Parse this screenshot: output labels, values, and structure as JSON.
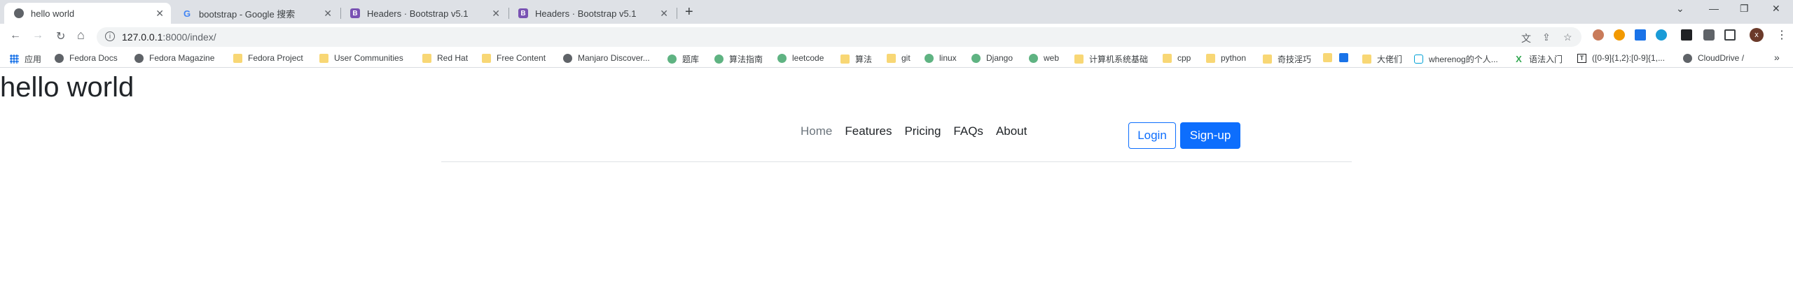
{
  "tabs": [
    {
      "title": "hello world",
      "icon": "globe-icon",
      "active": true
    },
    {
      "title": "bootstrap - Google 搜索",
      "icon": "google-icon"
    },
    {
      "title": "Headers · Bootstrap v5.1",
      "icon": "bootstrap-icon"
    },
    {
      "title": "Headers · Bootstrap v5.1",
      "icon": "bootstrap-icon"
    }
  ],
  "favicon_letters": {
    "google": "G",
    "bootstrap": "B"
  },
  "glyphs": {
    "close": "✕",
    "new_tab": "+",
    "back": "←",
    "forward": "→",
    "reload": "↻",
    "home": "⌂",
    "info": "i",
    "star": "☆",
    "share": "⇪",
    "translate": "文",
    "minimize": "—",
    "maximize": "❐",
    "window_close": "✕",
    "chevron_down": "⌄",
    "more": "⋮",
    "bookmarks_more": "»",
    "avatar_letter": "x"
  },
  "address": {
    "host": "127.0.0.1",
    "path": ":8000/index/"
  },
  "bookmarks": [
    {
      "label": "应用",
      "icon": "apps"
    },
    {
      "label": "Fedora Docs",
      "icon": "globe"
    },
    {
      "label": "Fedora Magazine",
      "icon": "globe"
    },
    {
      "label": "Fedora Project",
      "icon": "folder"
    },
    {
      "label": "User Communities",
      "icon": "folder"
    },
    {
      "label": "Red Hat",
      "icon": "folder"
    },
    {
      "label": "Free Content",
      "icon": "folder"
    },
    {
      "label": "Manjaro Discover...",
      "icon": "globe"
    },
    {
      "label": "题库",
      "icon": "green"
    },
    {
      "label": "算法指南",
      "icon": "green"
    },
    {
      "label": "leetcode",
      "icon": "green"
    },
    {
      "label": "算法",
      "icon": "folder"
    },
    {
      "label": "git",
      "icon": "folder"
    },
    {
      "label": "linux",
      "icon": "green"
    },
    {
      "label": "Django",
      "icon": "green"
    },
    {
      "label": "web",
      "icon": "green"
    },
    {
      "label": "计算机系统基础",
      "icon": "folder"
    },
    {
      "label": "cpp",
      "icon": "folder"
    },
    {
      "label": "python",
      "icon": "folder"
    },
    {
      "label": "奇技淫巧",
      "icon": "folder"
    },
    {
      "label": "",
      "icon": "folder"
    },
    {
      "label": "",
      "icon": "plane"
    },
    {
      "label": "大佬们",
      "icon": "folder"
    },
    {
      "label": "wherenog的个人...",
      "icon": "bili"
    },
    {
      "label": "语法入门",
      "icon": "x"
    },
    {
      "label": "([0-9]{1,2}:[0-9]{1,...",
      "icon": "text"
    },
    {
      "label": "CloudDrive /",
      "icon": "globe"
    }
  ],
  "page": {
    "heading": "hello world",
    "nav": [
      "Home",
      "Features",
      "Pricing",
      "FAQs",
      "About"
    ],
    "login": "Login",
    "signup": "Sign-up"
  },
  "colors": {
    "primary": "#0d6efd",
    "tabstrip": "#dee1e6",
    "muted": "#6c757d"
  }
}
